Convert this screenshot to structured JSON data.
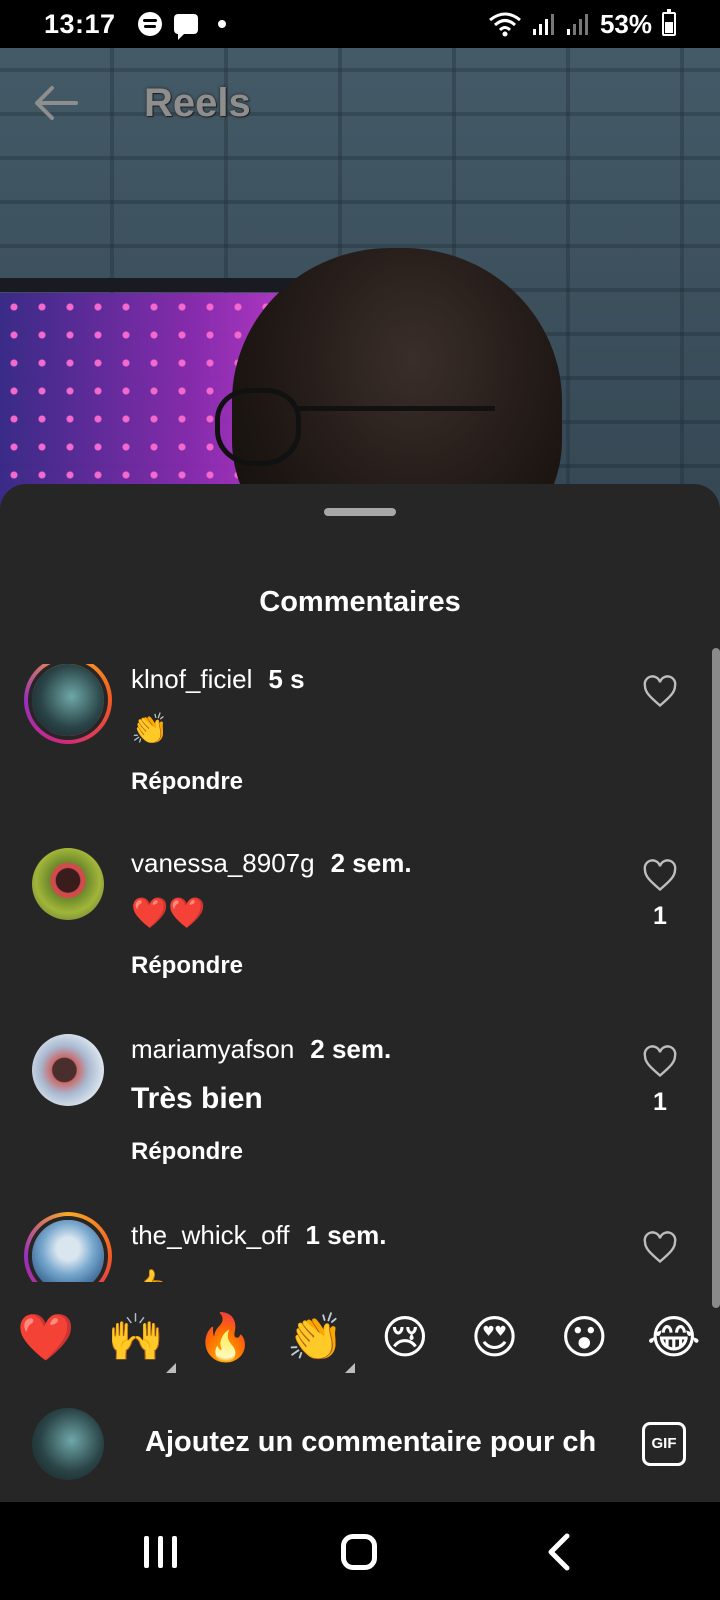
{
  "status_bar": {
    "time": "13:17",
    "icons": [
      "spotify-icon",
      "message-icon",
      "dot-icon",
      "wifi-icon",
      "signal-icon",
      "signal-icon"
    ],
    "battery": "53%"
  },
  "header": {
    "title": "Reels",
    "back_icon": "arrow-left-icon"
  },
  "sheet": {
    "title": "Commentaires",
    "comments": [
      {
        "username": "klnof_ficiel",
        "time": "5 s",
        "text": "👏",
        "reply": "Répondre",
        "likes": "",
        "story_ring": true
      },
      {
        "username": "vanessa_8907g",
        "time": "2 sem.",
        "text": "❤️❤️",
        "reply": "Répondre",
        "likes": "1",
        "story_ring": false
      },
      {
        "username": "mariamyafson",
        "time": "2 sem.",
        "text": "Très bien",
        "reply": "Répondre",
        "likes": "1",
        "story_ring": false
      },
      {
        "username": "the_whick_off",
        "time": "1 sem.",
        "text": "👍",
        "reply": "",
        "likes": "",
        "story_ring": true
      }
    ],
    "emoji_bar": [
      "❤️",
      "🙌",
      "🔥",
      "👏",
      "😢",
      "😍",
      "😮",
      "😂"
    ],
    "input": {
      "placeholder": "Ajoutez un commentaire pour ch",
      "gif_label": "GIF"
    }
  },
  "nav_bar": {
    "icons": [
      "recent-apps-icon",
      "home-icon",
      "back-icon"
    ]
  }
}
